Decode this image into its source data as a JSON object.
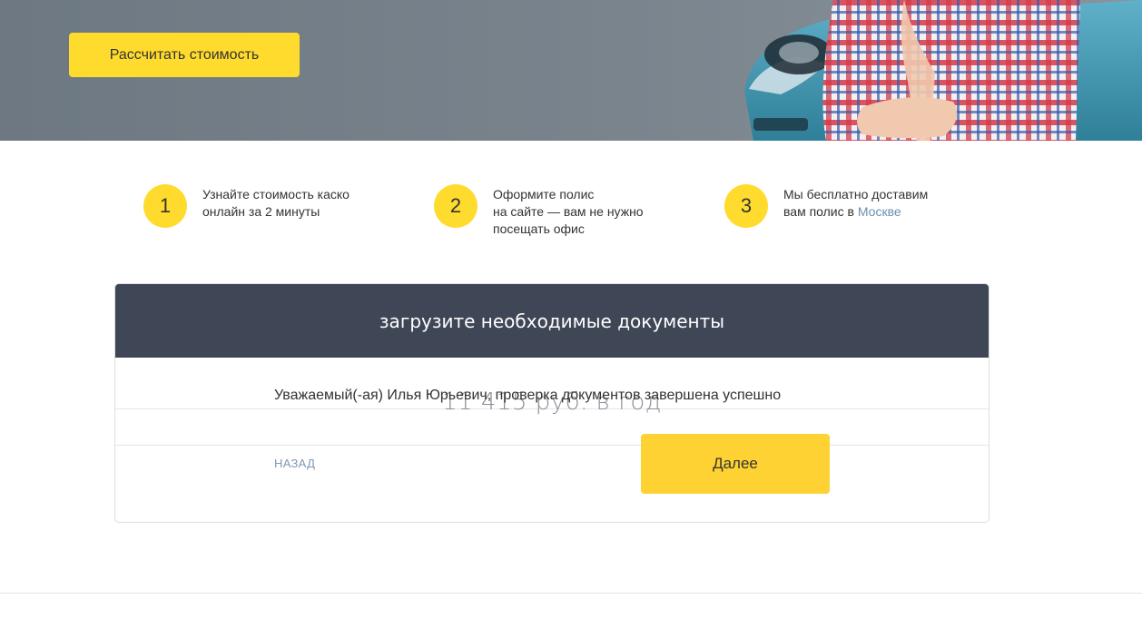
{
  "hero": {
    "cta_label": "Рассчитать стоимость"
  },
  "steps": [
    {
      "number": "1",
      "lines": [
        "Узнайте стоимость каско",
        "онлайн за 2 минуты"
      ]
    },
    {
      "number": "2",
      "lines": [
        "Оформите полис",
        "на сайте — вам не нужно",
        "посещать офис"
      ]
    },
    {
      "number": "3",
      "lines": [
        "Мы бесплатно доставим",
        "вам полис в "
      ],
      "link": "Москве"
    }
  ],
  "card": {
    "title": "загрузите необходимые документы",
    "price": "11 415 руб. в год",
    "status_message": "Уважаемый(-ая) Илья Юрьевич, проверка документов завершена успешно",
    "back_label": "НАЗАД",
    "next_label": "Далее"
  },
  "colors": {
    "accent_yellow": "#ffdb2d",
    "card_header": "#3f4656",
    "link": "#6b8fb0"
  }
}
